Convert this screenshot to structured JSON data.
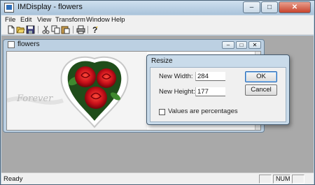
{
  "window": {
    "title": "IMDisplay - flowers"
  },
  "menu": {
    "items": [
      "File",
      "Edit",
      "View",
      "Transform",
      "Window",
      "Help"
    ]
  },
  "toolbar": {
    "buttons": [
      "new-file-icon",
      "open-folder-icon",
      "save-icon",
      "cut-icon",
      "copy-icon",
      "paste-icon",
      "print-icon",
      "help-icon"
    ]
  },
  "child": {
    "title": "flowers",
    "image_text": "Forever"
  },
  "dialog": {
    "title": "Resize",
    "width_label": "New Width:",
    "width_value": "284",
    "height_label": "New Height:",
    "height_value": "177",
    "checkbox_label": "Values are percentages",
    "ok_label": "OK",
    "cancel_label": "Cancel"
  },
  "status": {
    "text": "Ready",
    "num_indicator": "NUM"
  },
  "colors": {
    "rose": "#c8101a",
    "leaf": "#2f7a28",
    "accent": "#2b6ab6"
  }
}
